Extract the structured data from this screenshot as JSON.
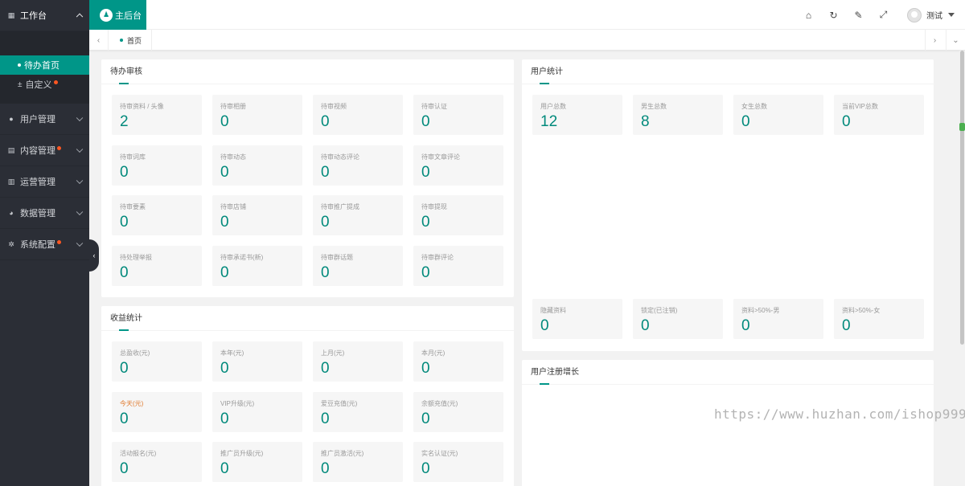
{
  "sidebar": {
    "menu": [
      {
        "label": "工作台",
        "icon": "grid-icon"
      },
      {
        "label": "用户管理",
        "icon": "user-icon"
      },
      {
        "label": "内容管理",
        "icon": "content-icon"
      },
      {
        "label": "运营管理",
        "icon": "chart-icon"
      },
      {
        "label": "数据管理",
        "icon": "pie-icon"
      },
      {
        "label": "系统配置",
        "icon": "gear-icon"
      }
    ],
    "submenu": [
      {
        "label": "待办首页"
      },
      {
        "label": "自定义"
      }
    ]
  },
  "header": {
    "logo_text": "主后台",
    "user_name": "测试"
  },
  "tabs": {
    "home": "首页"
  },
  "pending": {
    "title": "待办审核",
    "items": [
      {
        "label": "待审资料 / 头像",
        "value": "2"
      },
      {
        "label": "待审相册",
        "value": "0"
      },
      {
        "label": "待审视频",
        "value": "0"
      },
      {
        "label": "待审认证",
        "value": "0"
      },
      {
        "label": "待审词库",
        "value": "0"
      },
      {
        "label": "待审动态",
        "value": "0"
      },
      {
        "label": "待审动态评论",
        "value": "0"
      },
      {
        "label": "待审文章评论",
        "value": "0"
      },
      {
        "label": "待审要素",
        "value": "0"
      },
      {
        "label": "待审店铺",
        "value": "0"
      },
      {
        "label": "待审推广提成",
        "value": "0"
      },
      {
        "label": "待审提现",
        "value": "0"
      },
      {
        "label": "待处理举报",
        "value": "0"
      },
      {
        "label": "待审承诺书(新)",
        "value": "0"
      },
      {
        "label": "待审群话题",
        "value": "0"
      },
      {
        "label": "待审群评论",
        "value": "0"
      }
    ]
  },
  "revenue": {
    "title": "收益统计",
    "items": [
      {
        "label": "总盈收(元)",
        "value": "0"
      },
      {
        "label": "本年(元)",
        "value": "0"
      },
      {
        "label": "上月(元)",
        "value": "0"
      },
      {
        "label": "本月(元)",
        "value": "0"
      },
      {
        "label": "今天(元)",
        "value": "0"
      },
      {
        "label": "VIP升级(元)",
        "value": "0"
      },
      {
        "label": "爱豆充值(元)",
        "value": "0"
      },
      {
        "label": "余额充值(元)",
        "value": "0"
      },
      {
        "label": "活动报名(元)",
        "value": "0"
      },
      {
        "label": "推广员升级(元)",
        "value": "0"
      },
      {
        "label": "推广员激活(元)",
        "value": "0"
      },
      {
        "label": "实名认证(元)",
        "value": "0"
      }
    ]
  },
  "user_stats": {
    "title": "用户统计",
    "top": [
      {
        "label": "用户总数",
        "value": "12"
      },
      {
        "label": "男生总数",
        "value": "8"
      },
      {
        "label": "女生总数",
        "value": "0"
      },
      {
        "label": "当前VIP总数",
        "value": "0"
      }
    ],
    "bottom": [
      {
        "label": "隐藏资料",
        "value": "0"
      },
      {
        "label": "锁定(已注销)",
        "value": "0"
      },
      {
        "label": "资料>50%-男",
        "value": "0"
      },
      {
        "label": "资料>50%-女",
        "value": "0"
      }
    ]
  },
  "registration": {
    "title": "用户注册增长"
  },
  "watermark": "https://www.huzhan.com/ishop999",
  "colors": {
    "accent": "#009688",
    "sidebar": "#2b2e36",
    "value": "#00897b",
    "badge": "#ff5722"
  }
}
